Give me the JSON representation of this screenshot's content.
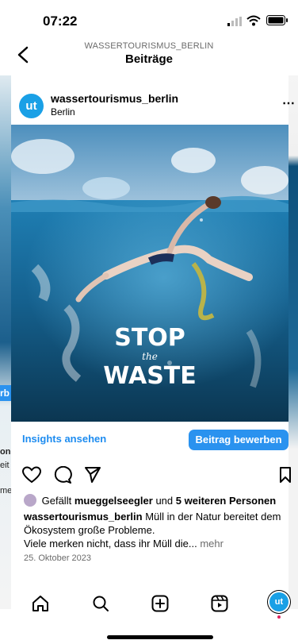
{
  "status_bar": {
    "time": "07:22"
  },
  "nav": {
    "account": "WASSERTOURISMUS_BERLIN",
    "title": "Beiträge"
  },
  "post": {
    "avatar_text": "ut",
    "username": "wassertourismus_berlin",
    "location": "Berlin",
    "image_title_line1": "STOP",
    "image_title_line2": "the",
    "image_title_line3": "WASTE",
    "insights_label": "Insights ansehen",
    "promote_label": "Beitrag bewerben",
    "likes_prefix": "Gefällt",
    "liked_by": "mueggelseegler",
    "likes_middle": "und",
    "likes_others": "5 weiteren Personen",
    "caption_user": "wassertourismus_berlin",
    "caption_text": "Müll in der Natur bereitet dem Ökosystem große Probleme.",
    "caption_line2": "Viele merken nicht, dass ihr Müll die...",
    "more_label": "mehr",
    "date": "25. Oktober 2023"
  },
  "background_fragments": {
    "left_1": "rb",
    "left_2": "one",
    "left_3": "eit",
    "left_4": "me"
  },
  "colors": {
    "accent_blue": "#2a92ef",
    "link_blue": "#1d8cf0",
    "brand_blue": "#1aa0e6"
  },
  "tabs": [
    "home-icon",
    "search-icon",
    "create-icon",
    "reels-icon",
    "profile-icon"
  ]
}
